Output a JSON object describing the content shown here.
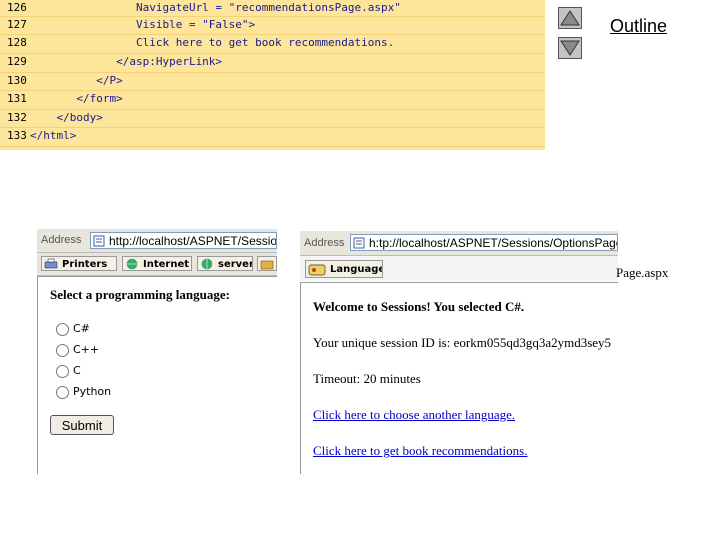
{
  "code": {
    "lines": [
      {
        "num": "126",
        "text": "                NavigateUrl = \"recommendationsPage.aspx\""
      },
      {
        "num": "127",
        "text": "                Visible = \"False\">"
      },
      {
        "num": "128",
        "text": "                Click here to get book recommendations."
      },
      {
        "num": "129",
        "text": "             </asp:HyperLink>"
      },
      {
        "num": "130",
        "text": "          </P>"
      },
      {
        "num": "131",
        "text": "       </form>"
      },
      {
        "num": "132",
        "text": "    </body>"
      },
      {
        "num": "133",
        "text": "</html>"
      }
    ]
  },
  "outline": {
    "label": "Outline"
  },
  "caption": {
    "text": "Page.aspx"
  },
  "browser1": {
    "address_label": "Address",
    "url": "http://localhost/ASPNET/Sessior",
    "links": [
      "Printers",
      "Internet",
      "server",
      "..."
    ],
    "heading": "Select a programming language:",
    "options": [
      "C#",
      "C++",
      "C",
      "Python"
    ],
    "submit_label": "Submit"
  },
  "browser2": {
    "address_label": "Address",
    "url": "h:tp://localhost/ASPNET/Sessions/OptionsPage.asp:",
    "links": [
      "Language"
    ],
    "welcome": "Welcome to Sessions! You selected C#.",
    "session_id": "Your unique session ID is: eorkm055qd3gq3a2ymd3sey5",
    "timeout": "Timeout: 20 minutes",
    "link_choose": "Click here to choose another language.",
    "link_books": "Click here to get book recommendations."
  },
  "colors": {
    "code_bg": "#fde59c",
    "code_text": "#1a1a8c",
    "link": "#0000cc"
  }
}
